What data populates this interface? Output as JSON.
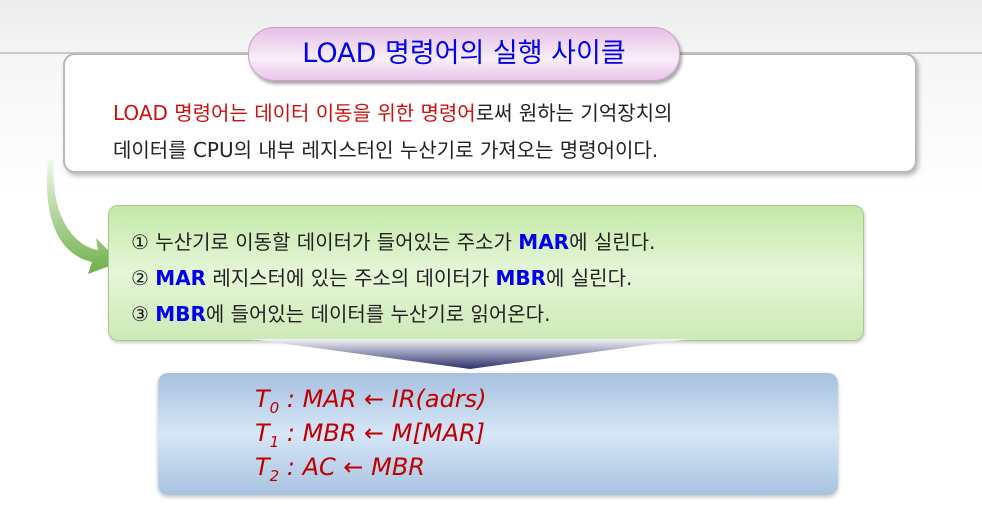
{
  "title": "LOAD 명령어의 실행 사이클",
  "description": {
    "line1_red": "LOAD 명령어는 데이터 이동을 위한 명령어",
    "line1_black": "로써 원하는 기억장치의",
    "line2": "데이터를 CPU의 내부 레지스터인 누산기로 가져오는 명령어이다."
  },
  "steps": [
    {
      "num": "①",
      "a": " 누산기로 이동할 데이터가 들어있는 주소가 ",
      "b": "MAR",
      "c": "에 실린다."
    },
    {
      "num": "②",
      "a": " ",
      "b": "MAR",
      "c": " 레지스터에 있는 주소의 데이터가 ",
      "d": "MBR",
      "e": "에 실린다."
    },
    {
      "num": "③",
      "a": " ",
      "b": "MBR",
      "c": "에 들어있는 데이터를 누산기로 읽어온다."
    }
  ],
  "micro_ops": [
    {
      "t": "T",
      "sub": "0",
      "op": ":  MAR ← IR(adrs)"
    },
    {
      "t": "T",
      "sub": "1",
      "op": ":  MBR ← M[MAR]"
    },
    {
      "t": "T",
      "sub": "2",
      "op": ":  AC ← MBR"
    }
  ],
  "colors": {
    "title": "#0000ee",
    "highlight": "#cc1010",
    "register": "#0000ee",
    "micro_op": "#c00000"
  }
}
